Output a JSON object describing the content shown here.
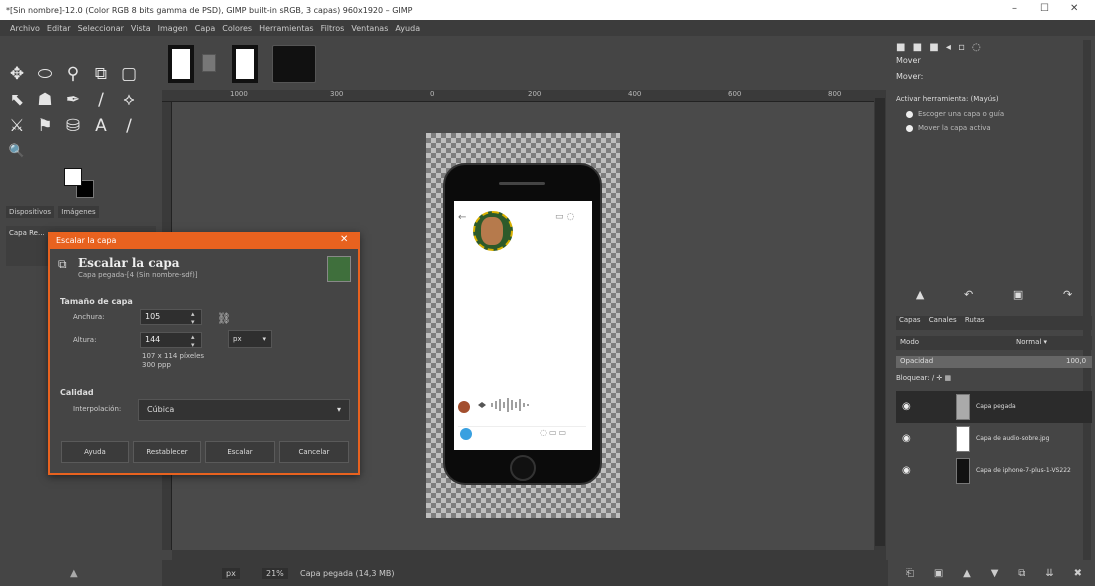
{
  "window": {
    "title": "*[Sin nombre]-12.0 (Color RGB 8 bits gamma de PSD), GIMP built-in sRGB, 3 capas) 960x1920 – GIMP",
    "min_label": "–",
    "max_label": "☐",
    "close_label": "✕"
  },
  "menu": [
    "Archivo",
    "Editar",
    "Seleccionar",
    "Vista",
    "Imagen",
    "Capa",
    "Colores",
    "Herramientas",
    "Filtros",
    "Ventanas",
    "Ayuda"
  ],
  "toolbox": {
    "tools": [
      "✥",
      "⬭",
      "⚲",
      "⧉",
      "▢",
      "⬉",
      "☗",
      "✒",
      "∕",
      "⟡",
      "⚔",
      "⚑",
      "⛁",
      "A",
      "∕",
      "🔍"
    ],
    "tabs": [
      "Dispositivos",
      "Imágenes"
    ],
    "options_title": "Capa Re...",
    "footer_icon": "▲"
  },
  "ruler": {
    "marks": [
      "1000",
      "300",
      "0",
      "200",
      "400",
      "600",
      "800",
      "1000"
    ]
  },
  "dialog": {
    "title": "Escalar la capa",
    "close": "✕",
    "heading": "Escalar la capa",
    "subtitle": "Capa pegada-[4 (Sin nombre-sdf)]",
    "size_section": "Tamaño de capa",
    "width_label": "Anchura:",
    "width_value": "105",
    "height_label": "Altura:",
    "height_value": "144",
    "unit": "px",
    "dims": [
      "107 x 114 píxeles",
      "300 ppp"
    ],
    "quality_section": "Calidad",
    "interp_label": "Interpolación:",
    "interp_value": "Cúbica",
    "buttons": [
      "Ayuda",
      "Restablecer",
      "Escalar",
      "Cancelar"
    ]
  },
  "status": {
    "unit": "px",
    "zoom": "21%",
    "message": "Capa pegada (14,3 MB)"
  },
  "right_panel": {
    "icon_row": "■ ■ ■ ◂ ▫ ◌",
    "title": "Mover",
    "mode_label": "Mover:",
    "activar": "Activar herramienta: (Mayús)",
    "radio1": "Escoger una capa o guía",
    "radio2": "Mover la capa activa",
    "tool_icons": [
      "▲",
      "↶",
      "▣",
      "↷"
    ],
    "tabs": [
      "Capas",
      "Canales",
      "Rutas"
    ],
    "mode": "Modo",
    "mode_value": "Normal ▾",
    "opacity_label": "Opacidad",
    "opacity_value": "100,0",
    "lock_label": "Bloquear: ∕ ✛ ▦",
    "layers": [
      {
        "name": "Capa pegada",
        "thumb_color": "#aaaaaa"
      },
      {
        "name": "Capa de audio-sobre.jpg",
        "thumb_color": "#ffffff"
      },
      {
        "name": "Capa de iphone-7-plus-1-VS222",
        "thumb_color": "#111111"
      }
    ],
    "bottom_icons": [
      "⎗",
      "▣",
      "▲",
      "▼",
      "⧉",
      "⇊",
      "✖"
    ]
  }
}
